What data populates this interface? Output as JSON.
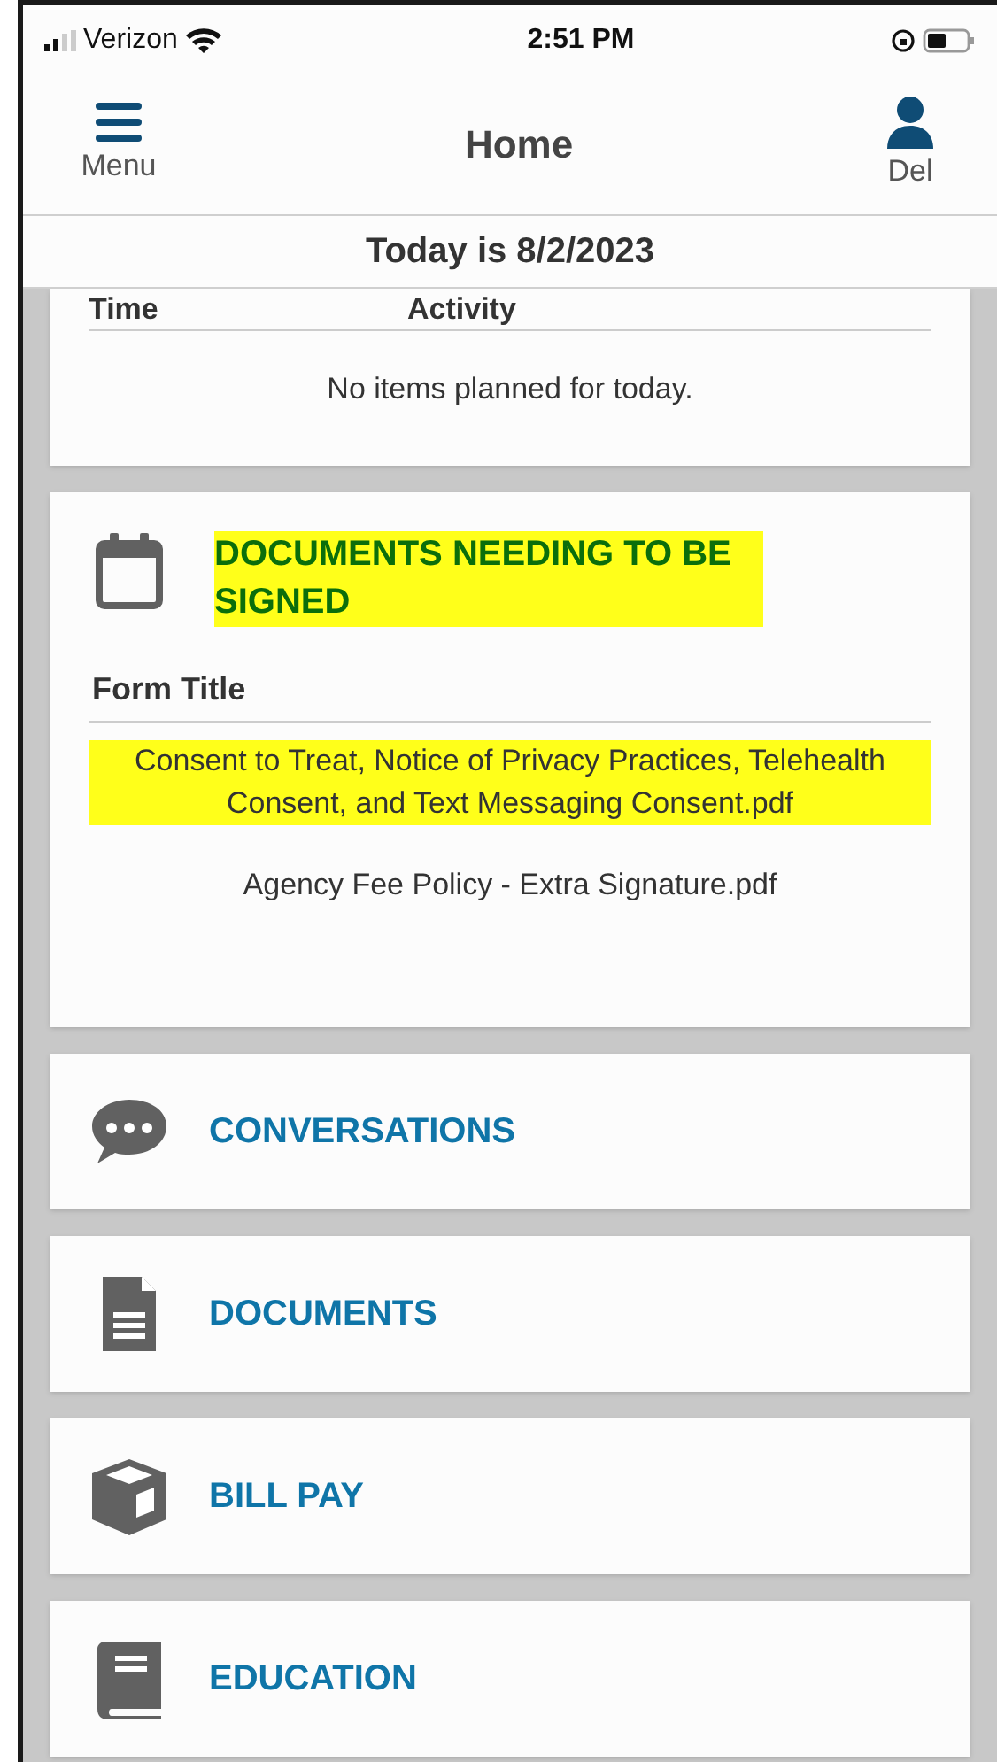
{
  "status_bar": {
    "carrier": "Verizon",
    "time": "2:51 PM"
  },
  "header": {
    "menu_label": "Menu",
    "title": "Home",
    "profile_label": "Del"
  },
  "date_bar": "Today is 8/2/2023",
  "schedule": {
    "columns": [
      "Time",
      "Activity"
    ],
    "empty_message": "No items planned for today."
  },
  "signing": {
    "title": "DOCUMENTS NEEDING TO BE SIGNED",
    "highlighted": true,
    "column": "Form Title",
    "rows": [
      {
        "title": "Consent to Treat, Notice of Privacy Practices, Telehealth Consent, and Text Messaging Consent.pdf",
        "highlighted": true
      },
      {
        "title": "Agency Fee Policy - Extra Signature.pdf",
        "highlighted": false
      }
    ]
  },
  "sections": [
    {
      "kind": "chat",
      "label": "CONVERSATIONS"
    },
    {
      "kind": "document",
      "label": "DOCUMENTS"
    },
    {
      "kind": "box",
      "label": "BILL PAY"
    },
    {
      "kind": "book",
      "label": "EDUCATION"
    }
  ]
}
